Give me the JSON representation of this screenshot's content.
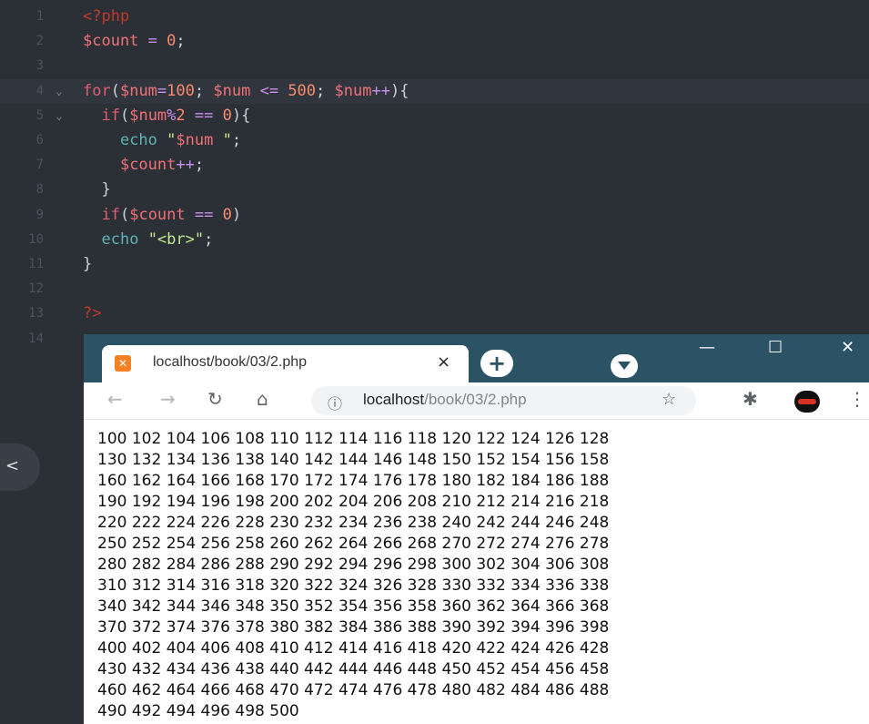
{
  "editor": {
    "lines": [
      {
        "n": "1",
        "html": "<span class='t-php'>&lt;?php</span>"
      },
      {
        "n": "2",
        "html": "<span class='t-var'>$count</span> <span class='t-op'>=</span> <span class='t-num'>0</span>;"
      },
      {
        "n": "3",
        "html": ""
      },
      {
        "n": "4",
        "html": "<span class='t-kw'>for</span>(<span class='t-var'>$num</span><span class='t-op'>=</span><span class='t-num'>100</span>; <span class='t-var'>$num</span> <span class='t-op'>&lt;=</span> <span class='t-num'>500</span>; <span class='t-var'>$num</span><span class='t-op'>++</span>){",
        "fold": "⌄",
        "active": true
      },
      {
        "n": "5",
        "html": "  <span class='t-kw'>if</span>(<span class='t-var'>$num</span><span class='t-op'>%</span><span class='t-num'>2</span> <span class='t-op'>==</span> <span class='t-num'>0</span>){",
        "fold": "⌄"
      },
      {
        "n": "6",
        "html": "    <span class='t-fn'>echo</span> <span class='t-str'>\"<span class='t-var'>$num</span> \"</span>;"
      },
      {
        "n": "7",
        "html": "    <span class='t-var'>$count</span><span class='t-op'>++</span>;"
      },
      {
        "n": "8",
        "html": "  }"
      },
      {
        "n": "9",
        "html": "  <span class='t-kw'>if</span>(<span class='t-var'>$count</span> <span class='t-op'>==</span> <span class='t-num'>0</span>)"
      },
      {
        "n": "10",
        "html": "  <span class='t-fn'>echo</span> <span class='t-str'>\"&lt;br&gt;\"</span>;"
      },
      {
        "n": "11",
        "html": "}"
      },
      {
        "n": "12",
        "html": ""
      },
      {
        "n": "13",
        "html": "<span class='t-php'>?&gt;</span>"
      },
      {
        "n": "14",
        "html": ""
      }
    ],
    "collapse_icon": "<"
  },
  "browser": {
    "tab_title": "localhost/book/03/2.php",
    "tab_close": "×",
    "new_tab": "+",
    "minimize": "—",
    "maximize": "☐",
    "close": "✕",
    "url_host": "localhost",
    "url_path": "/book/03/2.php",
    "output_lines": [
      "100 102 104 106 108 110 112 114 116 118 120 122 124 126 128",
      "130 132 134 136 138 140 142 144 146 148 150 152 154 156 158",
      "160 162 164 166 168 170 172 174 176 178 180 182 184 186 188",
      "190 192 194 196 198 200 202 204 206 208 210 212 214 216 218",
      "220 222 224 226 228 230 232 234 236 238 240 242 244 246 248",
      "250 252 254 256 258 260 262 264 266 268 270 272 274 276 278",
      "280 282 284 286 288 290 292 294 296 298 300 302 304 306 308",
      "310 312 314 316 318 320 322 324 326 328 330 332 334 336 338",
      "340 342 344 346 348 350 352 354 356 358 360 362 364 366 368",
      "370 372 374 376 378 380 382 384 386 388 390 392 394 396 398",
      "400 402 404 406 408 410 412 414 416 418 420 422 424 426 428",
      "430 432 434 436 438 440 442 444 446 448 450 452 454 456 458",
      "460 462 464 466 468 470 472 474 476 478 480 482 484 486 488",
      "490 492 494 496 498 500"
    ]
  }
}
